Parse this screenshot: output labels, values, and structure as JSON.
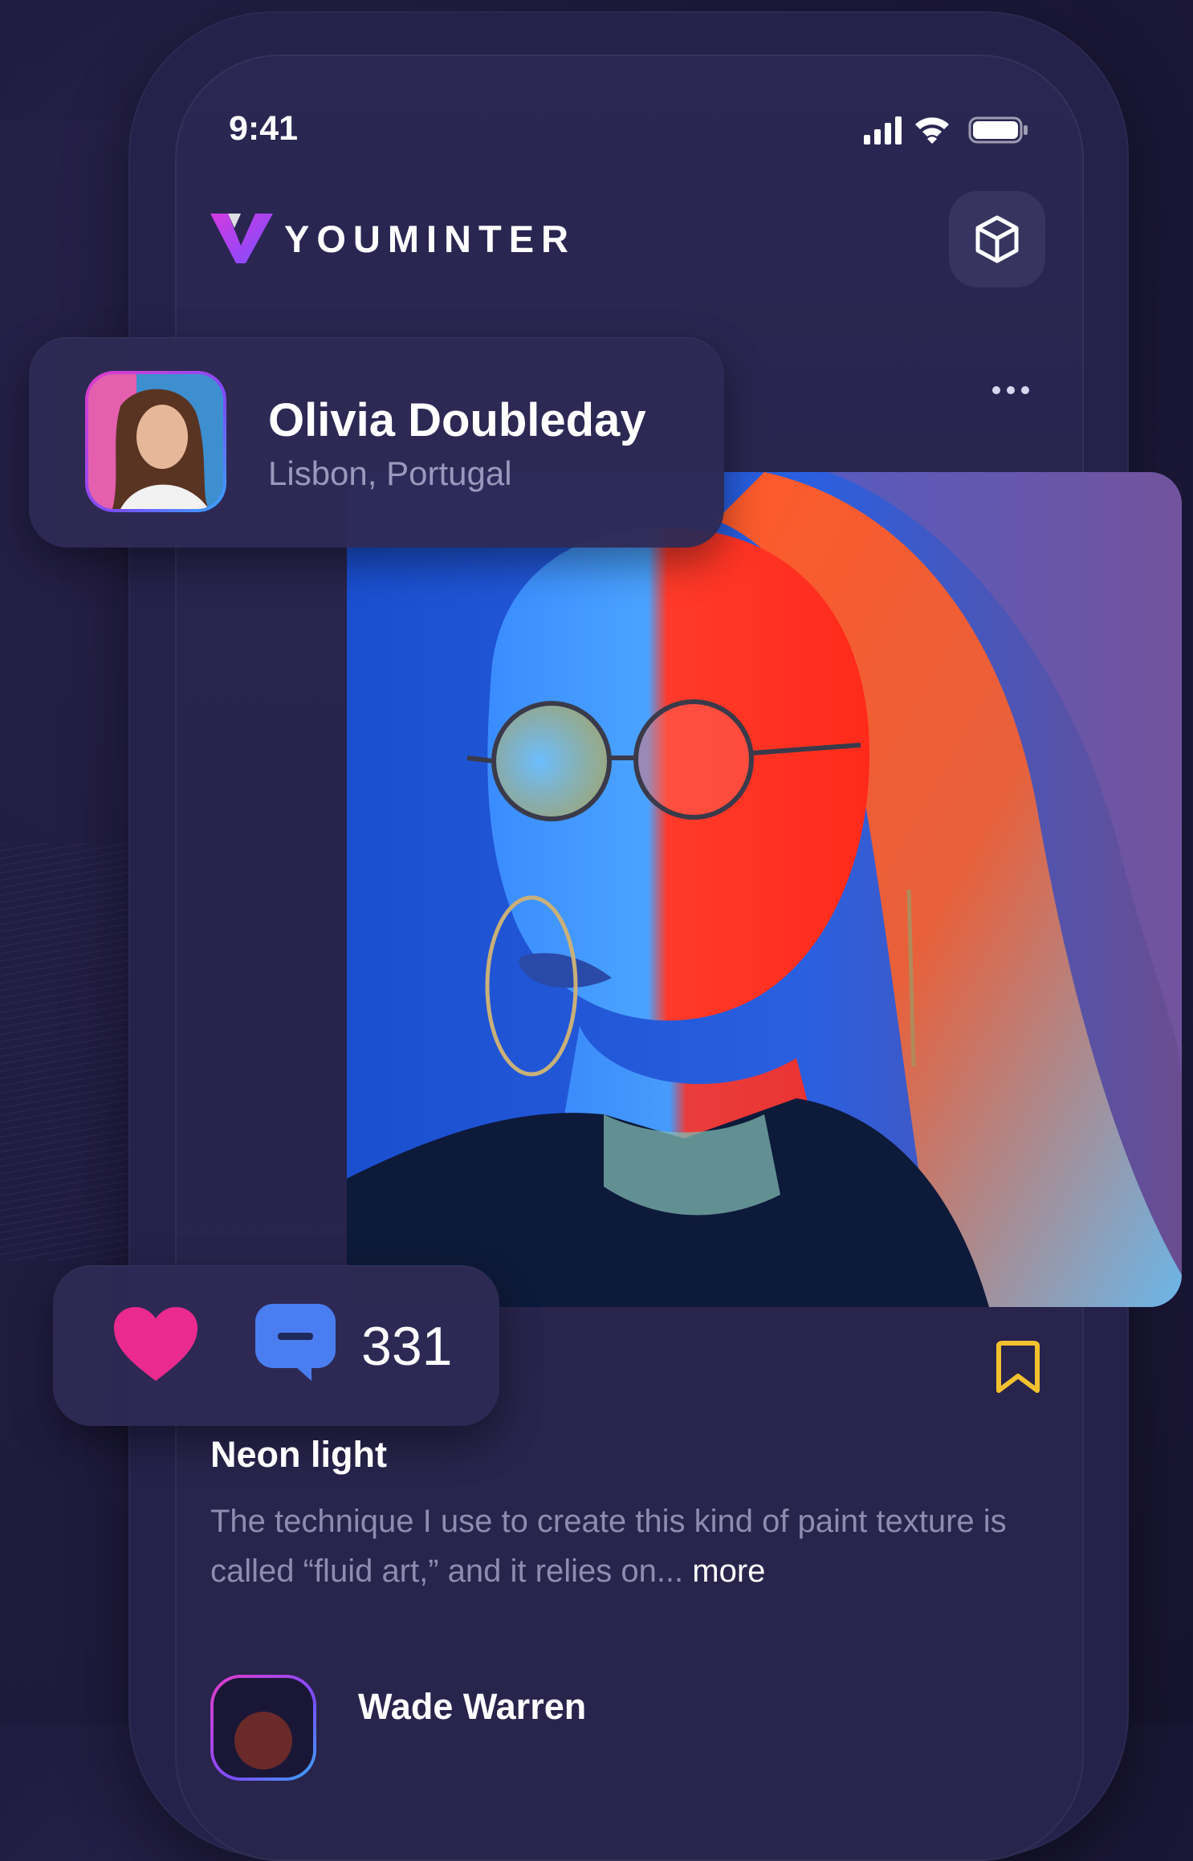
{
  "status_bar": {
    "time": "9:41"
  },
  "header": {
    "brand": "YOUMINTER",
    "cube_icon": "cube-icon",
    "logo_icon": "youminter-logo-icon"
  },
  "post": {
    "author": {
      "name": "Olivia Doubleday",
      "location": "Lisbon, Portugal"
    },
    "options_icon": "more-dots-icon",
    "comment_count": "331",
    "title": "Neon light",
    "description": "The technique I use to create this kind of paint texture is called “fluid art,” and it relies on...",
    "more_label": "more"
  },
  "comments": [
    {
      "name": "Wade Warren"
    }
  ],
  "colors": {
    "background": "#1d1a3c",
    "card": "#2e2a54",
    "heart": "#ea2a8e",
    "comment": "#4a7df0",
    "bookmark": "#f2c12e",
    "muted_text": "#8f8cb0"
  }
}
